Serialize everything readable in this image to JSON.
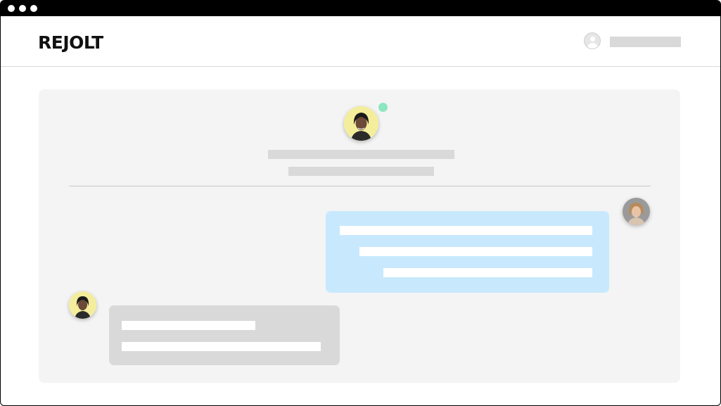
{
  "app": {
    "logo_text": "REJOLT"
  },
  "colors": {
    "titlebar": "#000000",
    "card_background": "#f4f4f4",
    "placeholder_gray": "#d9d9d9",
    "outgoing_bubble": "#c8e9fd",
    "incoming_bubble": "#d9d9d9",
    "online_status": "#8ee6c0",
    "avatar_contact_bg": "#f4ee9c",
    "avatar_self_bg": "#9a9a9a"
  },
  "header": {
    "user_icon": "user-icon",
    "user_name_placeholder": true
  },
  "chat": {
    "contact": {
      "avatar_icon": "contact-avatar",
      "status": "online",
      "name_placeholder": true,
      "subtitle_placeholder": true
    },
    "messages": [
      {
        "direction": "outgoing",
        "avatar_icon": "self-avatar",
        "lines": 3
      },
      {
        "direction": "incoming",
        "avatar_icon": "contact-avatar",
        "lines": 2
      }
    ]
  }
}
